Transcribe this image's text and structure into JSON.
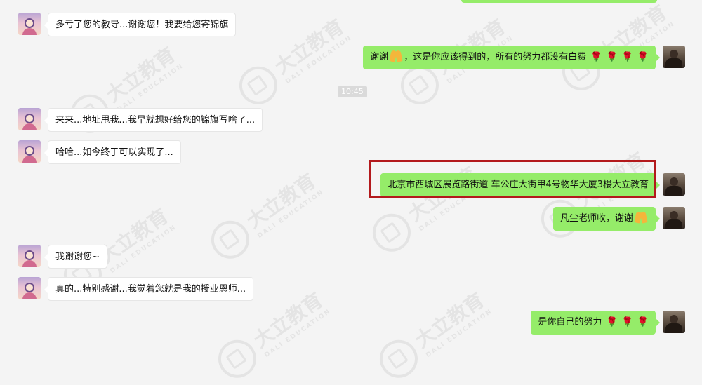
{
  "timestamp": "10:45",
  "watermark": {
    "brand": "大立教育",
    "sub": "DALI EDUCATION"
  },
  "messages": [
    {
      "side": "left",
      "text": "多亏了您的教导...谢谢您！我要给您寄锦旗",
      "avatar": "girl-avatar"
    },
    {
      "side": "right",
      "text": "谢谢",
      "suffix": "，这是你应该得到的，所有的努力都没有白费",
      "avatar": "man-avatar"
    },
    {
      "side": "left",
      "text": "来来...地址甩我...我早就想好给您的锦旗写啥了...",
      "avatar": "girl-avatar"
    },
    {
      "side": "left",
      "text": "哈哈...如今终于可以实现了...",
      "avatar": "girl-avatar"
    },
    {
      "side": "right",
      "text": "北京市西城区展览路街道 车公庄大街甲4号物华大厦3楼大立教育",
      "avatar": "man-avatar",
      "highlighted": true
    },
    {
      "side": "right",
      "text": "凡尘老师收，谢谢",
      "avatar": "man-avatar"
    },
    {
      "side": "left",
      "text": "我谢谢您~",
      "avatar": "girl-avatar"
    },
    {
      "side": "left",
      "text": "真的...特别感谢...我觉着您就是我的授业恩师...",
      "avatar": "girl-avatar"
    },
    {
      "side": "right",
      "text": "是你自己的努力",
      "avatar": "man-avatar"
    }
  ],
  "colors": {
    "sent_bubble": "#95ec69",
    "received_bubble": "#ffffff",
    "highlight_border": "#b3191c"
  }
}
